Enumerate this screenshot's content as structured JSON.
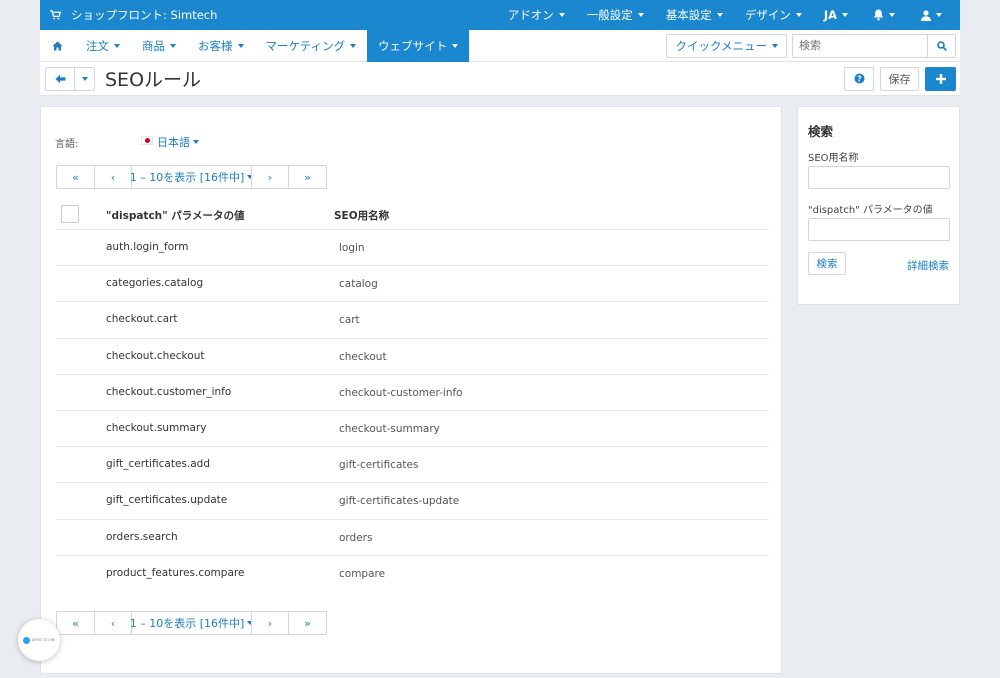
{
  "topbar": {
    "store": "ショップフロント: Simtech",
    "menus": [
      "アドオン",
      "一般設定",
      "基本設定",
      "デザイン",
      "JA"
    ],
    "icons": [
      "cart-icon",
      "bell-icon",
      "user-icon"
    ]
  },
  "mainnav": {
    "items": [
      "注文",
      "商品",
      "お客様",
      "マーケティング",
      "ウェブサイト"
    ],
    "active": "ウェブサイト",
    "quick_menu": "クイックメニュー",
    "search_placeholder": "検索"
  },
  "titlebar": {
    "title": "SEOルール",
    "save": "保存"
  },
  "language": {
    "label": "言語:",
    "value": "日本語"
  },
  "pagination": {
    "info": "1 – 10を表示 [16件中]",
    "first": "«",
    "prev": "‹",
    "next": "›",
    "last": "»"
  },
  "table": {
    "headers": [
      "\"dispatch\" パラメータの値",
      "SEO用名称"
    ],
    "rows": [
      [
        "auth.login_form",
        "login"
      ],
      [
        "categories.catalog",
        "catalog"
      ],
      [
        "checkout.cart",
        "cart"
      ],
      [
        "checkout.checkout",
        "checkout"
      ],
      [
        "checkout.customer_info",
        "checkout-customer-info"
      ],
      [
        "checkout.summary",
        "checkout-summary"
      ],
      [
        "gift_certificates.add",
        "gift-certificates"
      ],
      [
        "gift_certificates.update",
        "gift-certificates-update"
      ],
      [
        "orders.search",
        "orders"
      ],
      [
        "product_features.compare",
        "compare"
      ]
    ]
  },
  "sidebar": {
    "title": "検索",
    "label_seo": "SEO用名称",
    "label_dispatch": "\"dispatch\" パラメータの値",
    "search_button": "検索",
    "advanced": "詳細検索"
  },
  "widget": {
    "text": "DEMO STORE"
  },
  "colors": {
    "accent": "#1a87cf",
    "link": "#1a7fc6",
    "background": "#e9edf1"
  }
}
